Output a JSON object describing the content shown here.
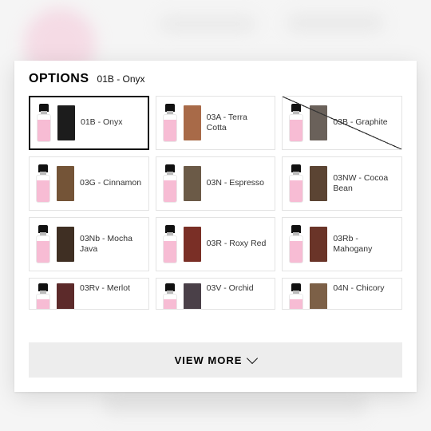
{
  "header": {
    "title": "OPTIONS",
    "selected": "01B - Onyx"
  },
  "viewmore_label": "VIEW MORE",
  "options": [
    {
      "code": "01B",
      "name": "Onyx",
      "swatch": "#1c1c1c",
      "selected": true,
      "disabled": false
    },
    {
      "code": "03A",
      "name": "Terra Cotta",
      "swatch": "#a86a48",
      "selected": false,
      "disabled": false
    },
    {
      "code": "03B",
      "name": "Graphite",
      "swatch": "#6a615a",
      "selected": false,
      "disabled": true
    },
    {
      "code": "03G",
      "name": "Cinnamon",
      "swatch": "#745437",
      "selected": false,
      "disabled": false
    },
    {
      "code": "03N",
      "name": "Espresso",
      "swatch": "#6b5a47",
      "selected": false,
      "disabled": false
    },
    {
      "code": "03NW",
      "name": "Cocoa Bean",
      "swatch": "#5b4433",
      "selected": false,
      "disabled": false
    },
    {
      "code": "03Nb",
      "name": "Mocha Java",
      "swatch": "#3f2f23",
      "selected": false,
      "disabled": false
    },
    {
      "code": "03R",
      "name": "Roxy Red",
      "swatch": "#7a2f26",
      "selected": false,
      "disabled": false
    },
    {
      "code": "03Rb",
      "name": "Mahogany",
      "swatch": "#6a3428",
      "selected": false,
      "disabled": false
    },
    {
      "code": "03Rv",
      "name": "Merlot",
      "swatch": "#5c2a2a",
      "selected": false,
      "disabled": false
    },
    {
      "code": "03V",
      "name": "Orchid",
      "swatch": "#4a4048",
      "selected": false,
      "disabled": false
    },
    {
      "code": "04N",
      "name": "Chicory",
      "swatch": "#7c6047",
      "selected": false,
      "disabled": false
    }
  ]
}
